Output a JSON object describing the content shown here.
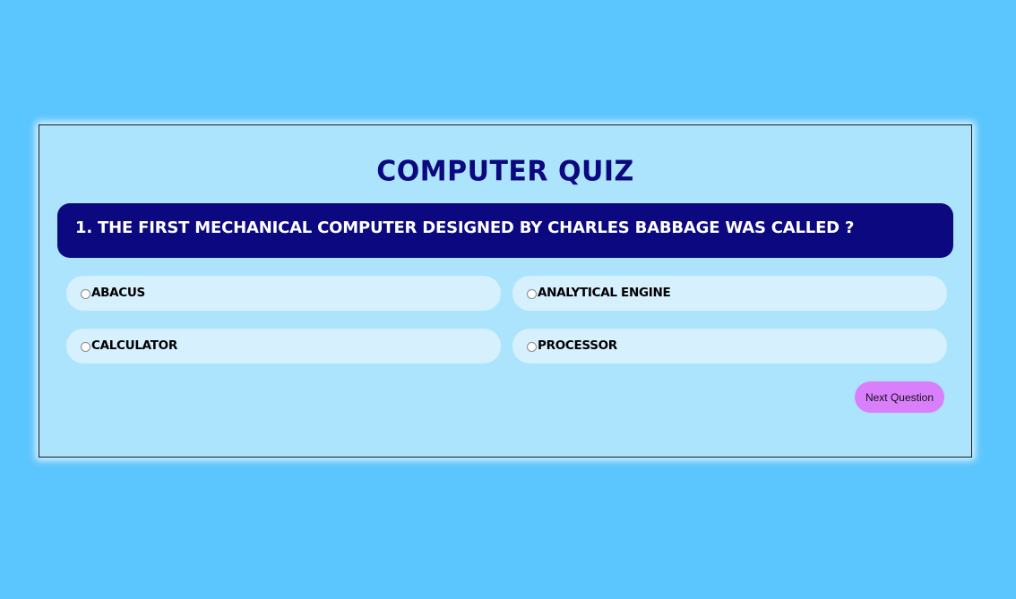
{
  "quiz": {
    "title": "Computer Quiz",
    "question": "1. The first mechanical computer designed by Charles Babbage was called ?",
    "options": [
      {
        "label": "Abacus",
        "selected": false
      },
      {
        "label": "Analytical Engine",
        "selected": false
      },
      {
        "label": "Calculator",
        "selected": false
      },
      {
        "label": "Processor",
        "selected": false
      }
    ],
    "next_label": "Next Question"
  },
  "colors": {
    "background": "#5bc5fd",
    "card": "#ace3fd",
    "question_bar": "#0b0880",
    "option_pill": "#d6f0fe",
    "next_button": "#d97ffb"
  }
}
